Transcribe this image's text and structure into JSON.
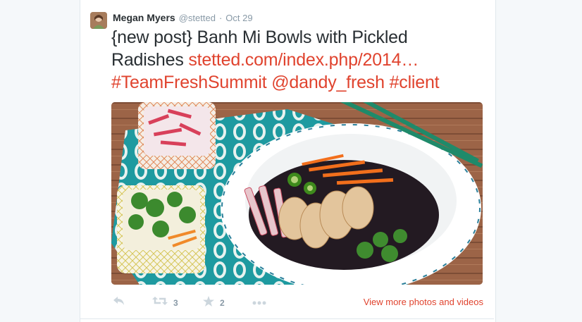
{
  "tweet": {
    "author_name": "Megan Myers",
    "handle": "@stetted",
    "separator": "·",
    "date": "Oct 29",
    "text_line1": "{new post} Banh Mi Bowls with Pickled",
    "text_plain2": "Radishes ",
    "link_url": "stetted.com/index.php/2014…",
    "hashtag1": "#TeamFreshSummit",
    "mention": "@dandy_fresh",
    "hashtag2": "#client"
  },
  "actions": {
    "retweet_count": "3",
    "favorite_count": "2",
    "view_more": "View more photos and videos"
  },
  "colors": {
    "link": "#e0432e",
    "text": "#292f33",
    "muted": "#8899a6",
    "icon": "#ccd6dd"
  },
  "icons": [
    "reply-icon",
    "retweet-icon",
    "star-icon",
    "more-icon"
  ]
}
